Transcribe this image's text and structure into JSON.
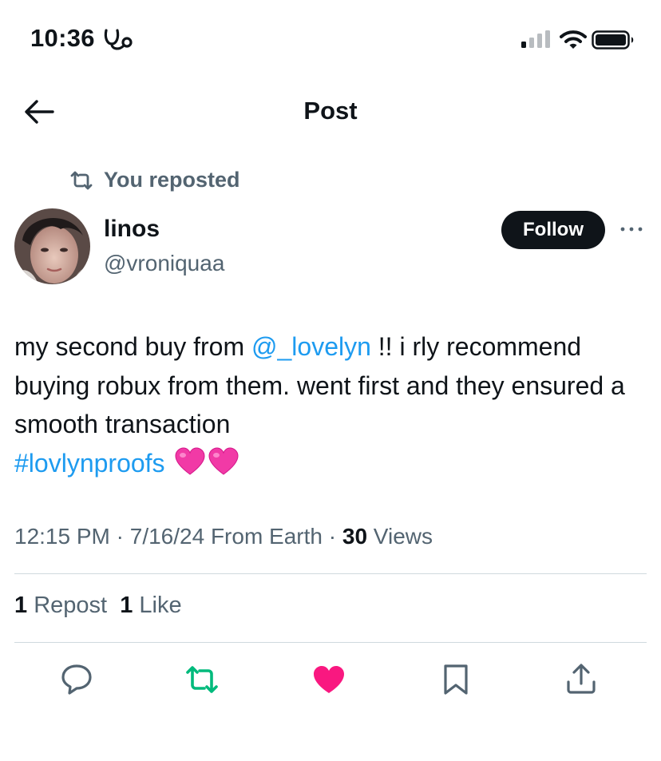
{
  "status_bar": {
    "time": "10:36"
  },
  "header": {
    "title": "Post"
  },
  "repost_indicator": {
    "text": "You reposted"
  },
  "author": {
    "name": "linos",
    "handle": "@vroniquaa",
    "follow_label": "Follow"
  },
  "post": {
    "text_part1": "my second buy from ",
    "mention": "@_lovelyn",
    "text_part2": " !! i rly recommend buying robux from them. went first and they ensured a smooth transaction",
    "hashtag": "#lovlynproofs",
    "emojis": [
      "pink-heart",
      "pink-heart"
    ]
  },
  "meta": {
    "time": "12:15 PM",
    "sep1": " · ",
    "date": "7/16/24",
    "source": " From Earth",
    "sep2": " · ",
    "views_count": "30",
    "views_label": " Views"
  },
  "stats": {
    "reposts_count": "1",
    "reposts_label": " Repost",
    "likes_count": "1",
    "likes_label": " Like"
  },
  "actions": [
    {
      "name": "reply",
      "icon": "comment-icon"
    },
    {
      "name": "repost",
      "icon": "repost-icon",
      "color": "#00ba7c"
    },
    {
      "name": "like",
      "icon": "heart-icon",
      "color": "#f91880"
    },
    {
      "name": "bookmark",
      "icon": "bookmark-icon"
    },
    {
      "name": "share",
      "icon": "share-icon"
    }
  ],
  "colors": {
    "link": "#1d9bf0",
    "secondary_text": "#536471",
    "repost_active": "#00ba7c",
    "like_active": "#f91880"
  }
}
